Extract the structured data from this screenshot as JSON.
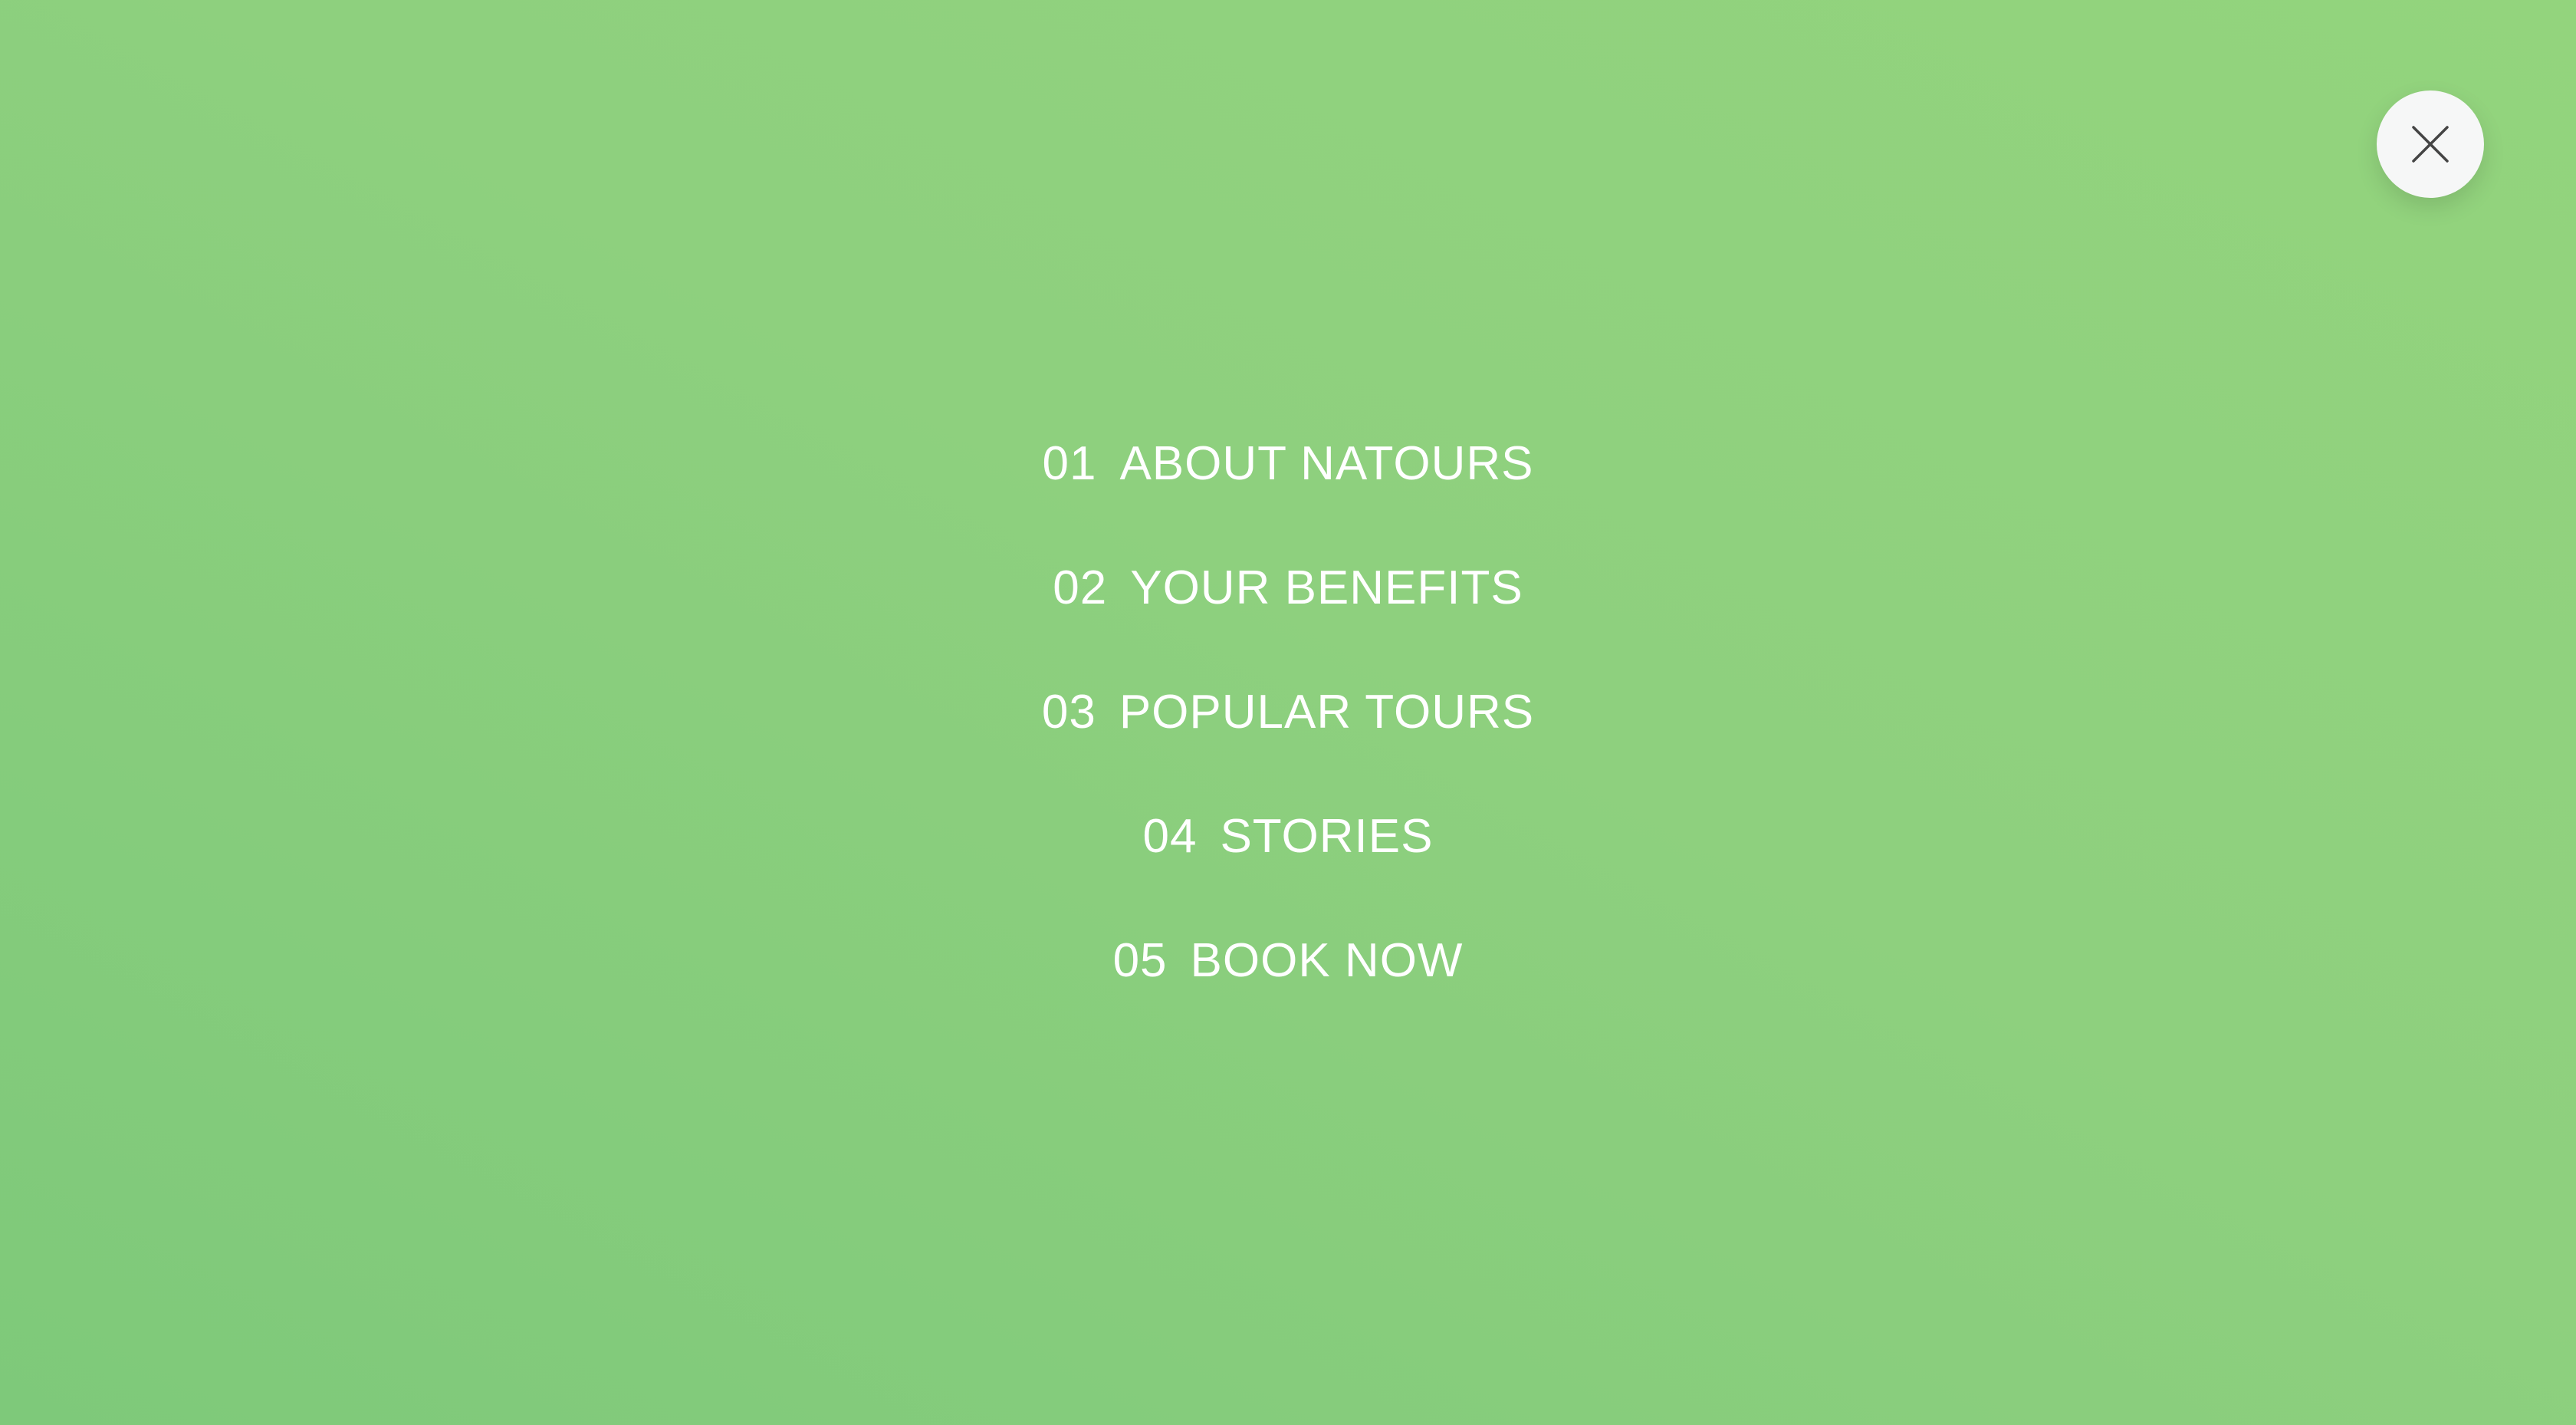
{
  "colors": {
    "background_start": "#7ec97a",
    "background_end": "#93d47d",
    "nav_text": "#ffffff",
    "close_button_bg": "#f6f7f7",
    "close_icon": "#444444"
  },
  "close_button": {
    "icon": "close-icon"
  },
  "nav": {
    "items": [
      {
        "number": "01",
        "label": "ABOUT NATOURS"
      },
      {
        "number": "02",
        "label": "YOUR BENEFITS"
      },
      {
        "number": "03",
        "label": "POPULAR TOURS"
      },
      {
        "number": "04",
        "label": "STORIES"
      },
      {
        "number": "05",
        "label": "BOOK NOW"
      }
    ]
  }
}
